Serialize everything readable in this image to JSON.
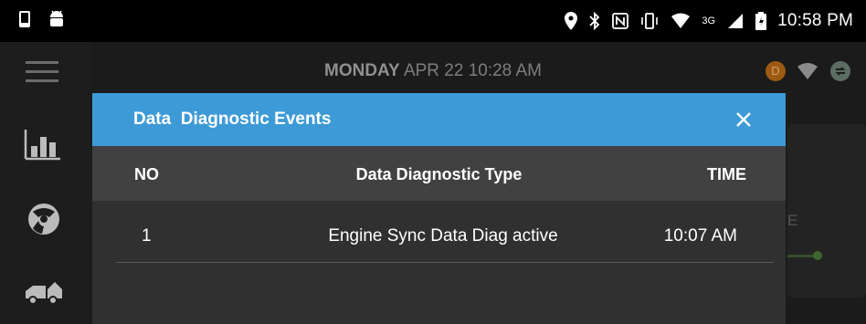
{
  "status_bar": {
    "time": "10:58 PM",
    "network_label": "3G"
  },
  "header": {
    "day": "MONDAY",
    "datetime": "APR 22 10:28 AM",
    "avatar_initial": "D"
  },
  "background": {
    "card_text": "E"
  },
  "dialog": {
    "title": "Data  Diagnostic Events",
    "columns": [
      "NO",
      "Data Diagnostic Type",
      "TIME"
    ],
    "rows": [
      {
        "no": "1",
        "type": "Engine Sync Data Diag active",
        "time": "10:07 AM"
      }
    ]
  },
  "colors": {
    "dialog_header": "#3d9ad6",
    "dialog_body": "#303030",
    "table_header": "#414141",
    "avatar": "#9c5a12"
  }
}
